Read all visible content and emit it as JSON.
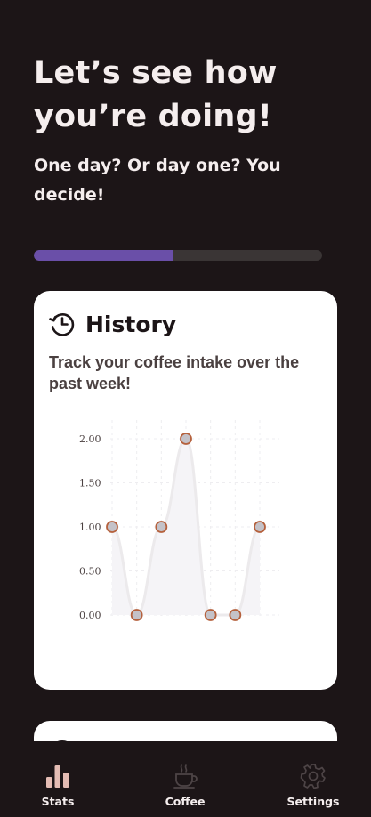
{
  "header": {
    "title": "Let’s see how you’re doing!",
    "subtitle": "One day? Or day one? You decide!"
  },
  "progress": {
    "value": 0.48
  },
  "history_card": {
    "icon": "history-icon",
    "title": "History",
    "description": "Track your coffee intake over the past week!"
  },
  "chart_data": {
    "type": "line",
    "title": "",
    "xlabel": "",
    "ylabel": "",
    "x": [
      1,
      2,
      3,
      4,
      5,
      6,
      7
    ],
    "series": [
      {
        "values": [
          1,
          0,
          1,
          2,
          0,
          0,
          1
        ]
      }
    ],
    "ylim": [
      0,
      2
    ],
    "yticks": [
      "0.00",
      "0.50",
      "1.00",
      "1.50",
      "2.00"
    ],
    "grid": true,
    "smooth": true,
    "colors": {
      "line": "#eceaec",
      "fill": "#f5f4f7",
      "point_fill": "#c4c2c8",
      "point_stroke": "#b5613d"
    }
  },
  "next_card": {
    "icon": "circle-icon"
  },
  "bottom_nav": {
    "items": [
      {
        "label": "Stats",
        "icon": "bar-chart-icon",
        "active": true
      },
      {
        "label": "Coffee",
        "icon": "coffee-cup-icon",
        "active": false
      },
      {
        "label": "Settings",
        "icon": "gear-icon",
        "active": false
      }
    ]
  },
  "colors": {
    "background": "#1c1517",
    "accent": "#6a4fa8",
    "card": "#ffffff",
    "nav_active": "#e4bcb4",
    "nav_inactive": "#4d4446"
  }
}
